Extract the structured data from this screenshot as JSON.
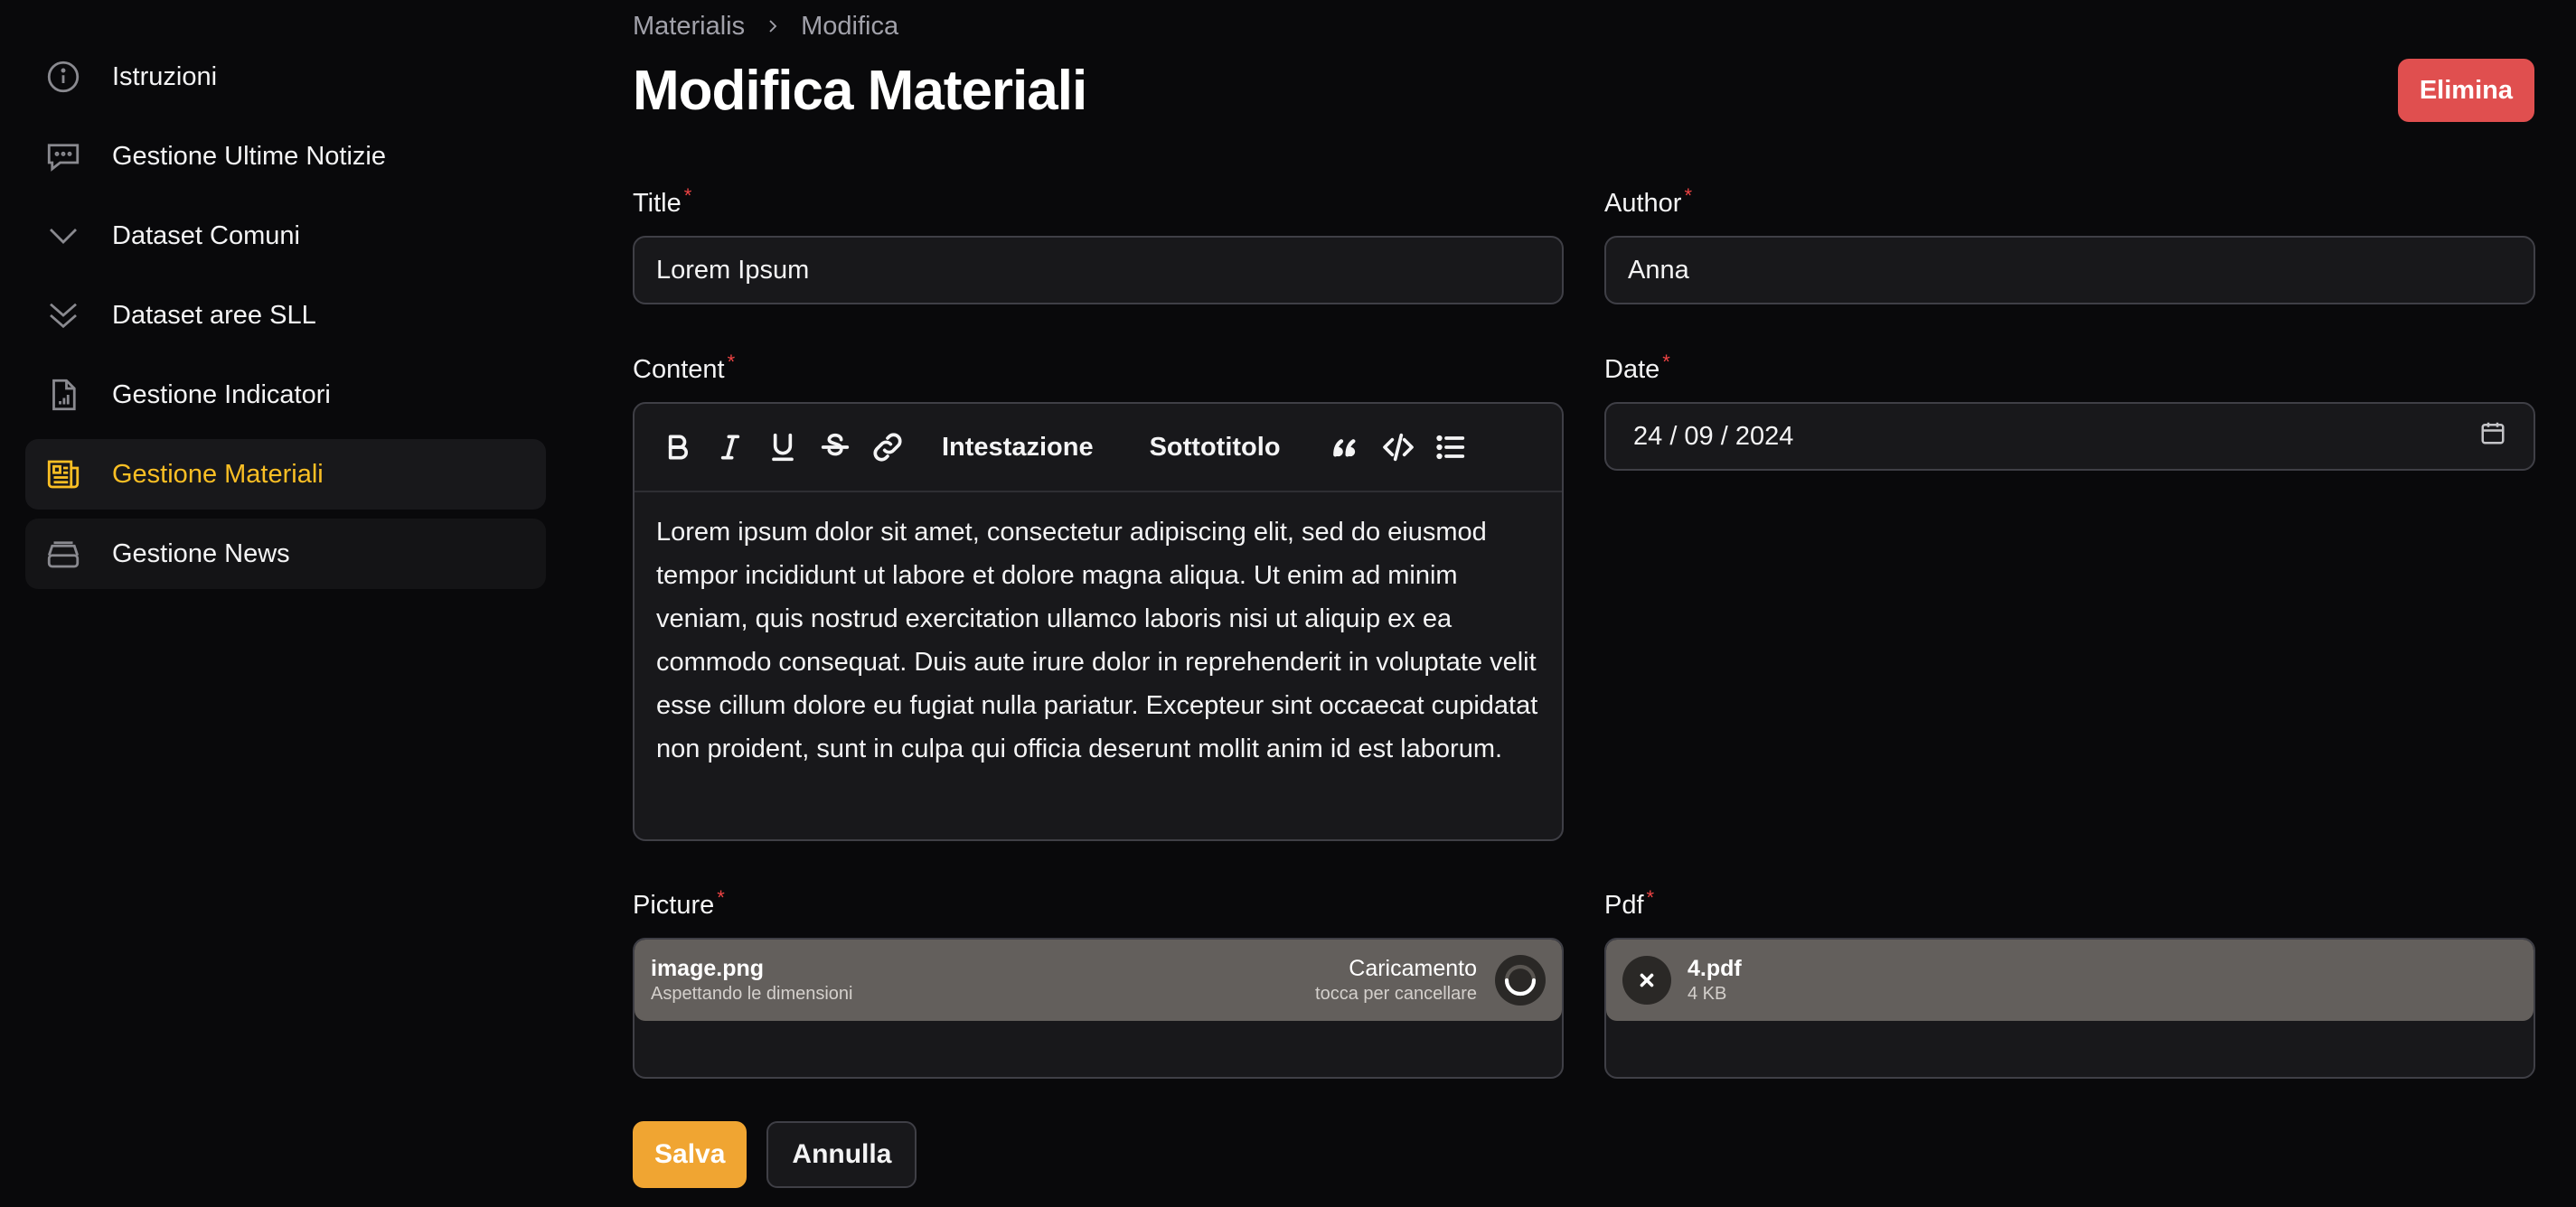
{
  "sidebar": {
    "items": [
      {
        "label": "Istruzioni",
        "icon": "info-icon"
      },
      {
        "label": "Gestione Ultime Notizie",
        "icon": "chat-icon"
      },
      {
        "label": "Dataset Comuni",
        "icon": "chevron-down-icon"
      },
      {
        "label": "Dataset aree SLL",
        "icon": "chevron-double-down-icon"
      },
      {
        "label": "Gestione Indicatori",
        "icon": "document-chart-icon"
      },
      {
        "label": "Gestione Materiali",
        "icon": "newspaper-icon",
        "active": true
      },
      {
        "label": "Gestione News",
        "icon": "inbox-stack-icon"
      }
    ]
  },
  "breadcrumb": {
    "parent": "Materialis",
    "current": "Modifica"
  },
  "header": {
    "title": "Modifica Materiali",
    "delete_label": "Elimina"
  },
  "form": {
    "title": {
      "label": "Title",
      "required": "*",
      "value": "Lorem Ipsum"
    },
    "author": {
      "label": "Author",
      "required": "*",
      "value": "Anna"
    },
    "content": {
      "label": "Content",
      "required": "*",
      "toolbar": {
        "heading": "Intestazione",
        "subheading": "Sottotitolo"
      },
      "value": "Lorem ipsum dolor sit amet, consectetur adipiscing elit, sed do eiusmod tempor incididunt ut labore et dolore magna aliqua. Ut enim ad minim veniam, quis nostrud exercitation ullamco laboris nisi ut aliquip ex ea commodo consequat. Duis aute irure dolor in reprehenderit in voluptate velit esse cillum dolore eu fugiat nulla pariatur. Excepteur sint occaecat cupidatat non proident, sunt in culpa qui officia deserunt mollit anim id est laborum."
    },
    "date": {
      "label": "Date",
      "required": "*",
      "value": "24 / 09 / 2024"
    },
    "picture": {
      "label": "Picture",
      "required": "*",
      "file_name": "image.png",
      "file_sub": "Aspettando le dimensioni",
      "status": "Caricamento",
      "status_sub": "tocca per cancellare"
    },
    "pdf": {
      "label": "Pdf",
      "required": "*",
      "file_name": "4.pdf",
      "file_size": "4 KB"
    }
  },
  "actions": {
    "save_label": "Salva",
    "cancel_label": "Annulla"
  },
  "colors": {
    "accent": "#fbbf24",
    "danger": "#e04f4f",
    "primary_button": "#f0a532",
    "background": "#09090b"
  }
}
